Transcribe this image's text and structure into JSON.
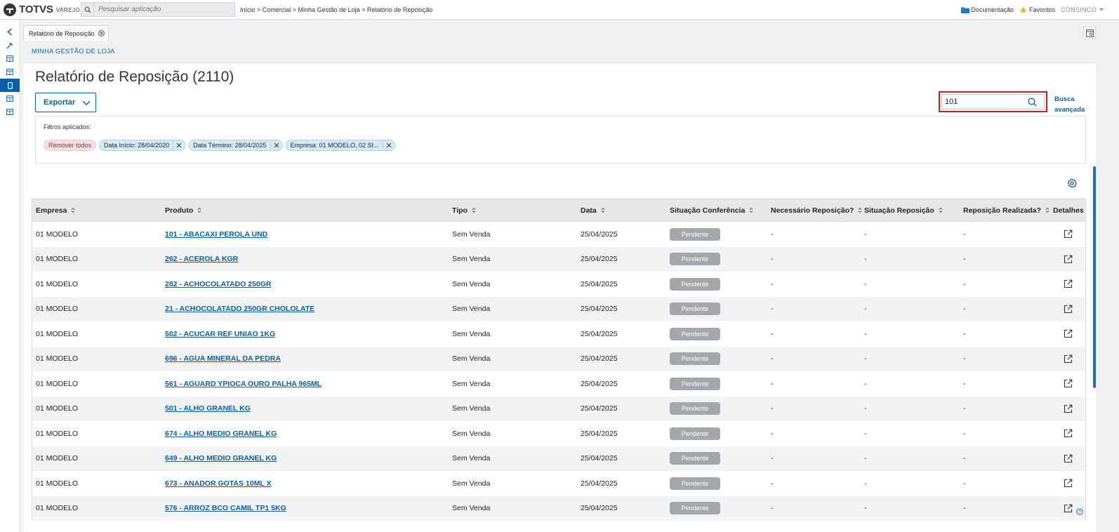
{
  "brand": {
    "name": "TOTVS",
    "sub": "VAREJO"
  },
  "app_search": {
    "placeholder": "Pesquisar aplicação"
  },
  "breadcrumb": "Início > Comercial > Minha Gestão de Loja > Relatório de Reposição",
  "topbar": {
    "documentation": "Documentação",
    "favorites": "Favoritos",
    "user": "CONSINCO"
  },
  "tab": {
    "label": "Relatório de Reposição"
  },
  "panel": {
    "section": "MINHA GESTÃO DE LOJA",
    "title": "Relatório de Reposição (2110)"
  },
  "toolbar": {
    "export_label": "Exportar"
  },
  "search": {
    "value": "101"
  },
  "advanced_search": {
    "line1": "Busca",
    "line2": "avançada"
  },
  "filters": {
    "label": "Filtros aplicados:",
    "remove_all": "Remover todos",
    "chips": [
      "Data Início: 28/04/2020",
      "Data Término: 28/04/2025",
      "Empresa: 01 MODELO, 02 SI..."
    ]
  },
  "table": {
    "columns": [
      "Empresa",
      "Produto",
      "Tipo",
      "Data",
      "Situação Conferência",
      "Necessário Reposição?",
      "Situação Reposição",
      "Reposição Realizada?",
      "Detalhes"
    ],
    "rows": [
      {
        "empresa": "01 MODELO",
        "produto": "101 - ABACAXI PEROLA UND",
        "tipo": "Sem Venda",
        "data": "25/04/2025",
        "situacao": "Pendente",
        "necessario": "-",
        "sit_reposicao": "-",
        "realizada": "-"
      },
      {
        "empresa": "01 MODELO",
        "produto": "262 - ACEROLA KGR",
        "tipo": "Sem Venda",
        "data": "25/04/2025",
        "situacao": "Pendente",
        "necessario": "-",
        "sit_reposicao": "-",
        "realizada": "-"
      },
      {
        "empresa": "01 MODELO",
        "produto": "282 - ACHOCOLATADO 250GR",
        "tipo": "Sem Venda",
        "data": "25/04/2025",
        "situacao": "Pendente",
        "necessario": "-",
        "sit_reposicao": "-",
        "realizada": "-"
      },
      {
        "empresa": "01 MODELO",
        "produto": "21 - ACHOCOLATADO 250GR CHOLOLATE",
        "tipo": "Sem Venda",
        "data": "25/04/2025",
        "situacao": "Pendente",
        "necessario": "-",
        "sit_reposicao": "-",
        "realizada": "-"
      },
      {
        "empresa": "01 MODELO",
        "produto": "502 - ACUCAR REF UNIAO 1KG",
        "tipo": "Sem Venda",
        "data": "25/04/2025",
        "situacao": "Pendente",
        "necessario": "-",
        "sit_reposicao": "-",
        "realizada": "-"
      },
      {
        "empresa": "01 MODELO",
        "produto": "696 - AGUA MINERAL DA PEDRA",
        "tipo": "Sem Venda",
        "data": "25/04/2025",
        "situacao": "Pendente",
        "necessario": "-",
        "sit_reposicao": "-",
        "realizada": "-"
      },
      {
        "empresa": "01 MODELO",
        "produto": "561 - AGUARD YPIOCA OURO PALHA 965ML",
        "tipo": "Sem Venda",
        "data": "25/04/2025",
        "situacao": "Pendente",
        "necessario": "-",
        "sit_reposicao": "-",
        "realizada": "-"
      },
      {
        "empresa": "01 MODELO",
        "produto": "501 - ALHO GRANEL KG",
        "tipo": "Sem Venda",
        "data": "25/04/2025",
        "situacao": "Pendente",
        "necessario": "-",
        "sit_reposicao": "-",
        "realizada": "-"
      },
      {
        "empresa": "01 MODELO",
        "produto": "674 - ALHO MEDIO GRANEL KG",
        "tipo": "Sem Venda",
        "data": "25/04/2025",
        "situacao": "Pendente",
        "necessario": "-",
        "sit_reposicao": "-",
        "realizada": "-"
      },
      {
        "empresa": "01 MODELO",
        "produto": "649 - ALHO MEDIO GRANEL KG",
        "tipo": "Sem Venda",
        "data": "25/04/2025",
        "situacao": "Pendente",
        "necessario": "-",
        "sit_reposicao": "-",
        "realizada": "-"
      },
      {
        "empresa": "01 MODELO",
        "produto": "673 - ANADOR GOTAS 10ML X",
        "tipo": "Sem Venda",
        "data": "25/04/2025",
        "situacao": "Pendente",
        "necessario": "-",
        "sit_reposicao": "-",
        "realizada": "-"
      },
      {
        "empresa": "01 MODELO",
        "produto": "576 - ARROZ BCO CAMIL TP1 5KG",
        "tipo": "Sem Venda",
        "data": "25/04/2025",
        "situacao": "Pendente",
        "necessario": "-",
        "sit_reposicao": "-",
        "realizada": "-"
      }
    ]
  },
  "colors": {
    "primary": "#0a5fa8",
    "highlight": "#d0191b",
    "badge": "#a3a7ab",
    "chip": "#d4ecf8",
    "remove_chip": "#f6dede"
  },
  "icons": [
    "search-icon",
    "folder-icon",
    "star-icon",
    "chevron-down-icon",
    "back-arrow-icon",
    "pin-icon",
    "grid-icon",
    "mobile-icon",
    "close-circle-icon",
    "close-icon",
    "gear-icon",
    "sort-icon",
    "external-link-icon",
    "help-icon"
  ]
}
